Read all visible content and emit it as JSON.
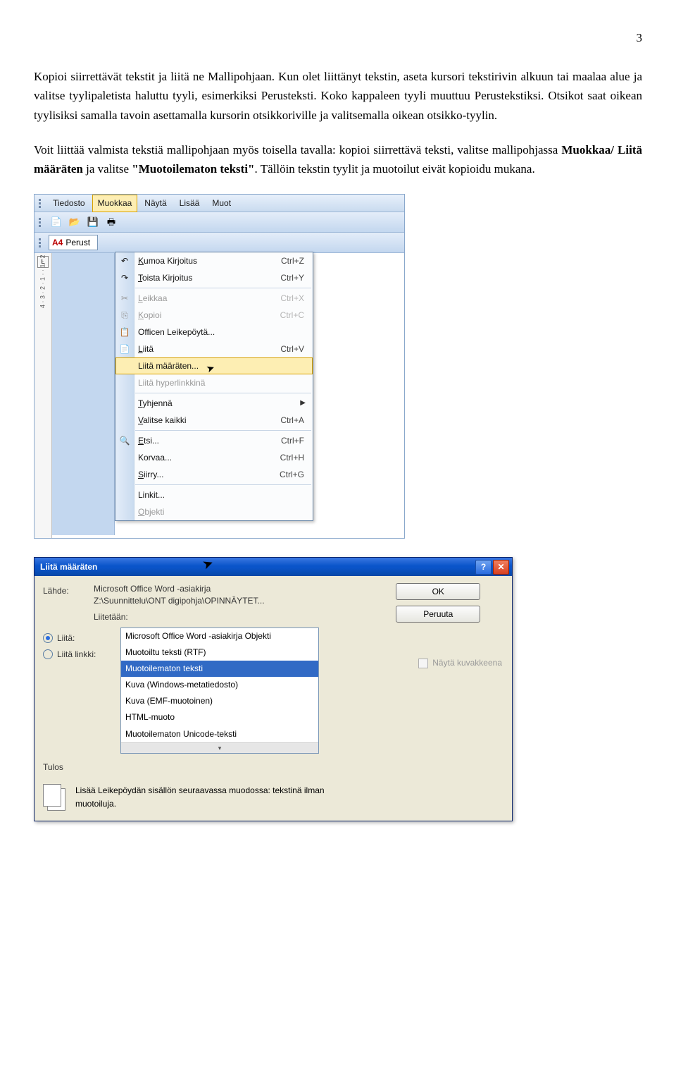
{
  "page_number": "3",
  "paragraphs": {
    "p1": "Kopioi siirrettävät tekstit ja liitä ne Mallipohjaan. Kun olet liittänyt tekstin, aseta kursori tekstirivin alkuun tai maalaa alue ja valitse tyylipaletista haluttu tyyli, esimerkiksi Perusteksti. Koko kappaleen tyyli muuttuu Perustekstiksi. Otsikot saat oikean tyylisiksi samalla tavoin asettamalla kursorin otsikkoriville ja valitsemalla oikean otsikko-tyylin.",
    "p2_a": "Voit liittää valmista tekstiä mallipohjaan myös toisella tavalla: kopioi siirrettävä teksti, valitse mallipohjassa ",
    "p2_b": "Muokkaa/ Liitä määräten",
    "p2_c": " ja valitse ",
    "p2_d": "\"Muotoilematon teksti\"",
    "p2_e": ". Tällöin tekstin tyylit ja muotoilut eivät kopioidu mukana."
  },
  "word_ui": {
    "menubar": [
      "Tiedosto",
      "Muokkaa",
      "Näytä",
      "Lisää",
      "Muot"
    ],
    "style_prefix": "A4",
    "style_name": "Perust",
    "ruler_L": "L",
    "ruler_ticks": [
      "·",
      "1",
      "·",
      "2",
      "·",
      "1",
      "·",
      "1",
      "·",
      "·",
      "2",
      "·",
      "3",
      "·",
      "4"
    ],
    "menu_items": [
      {
        "label_pre": "K",
        "label_rest": "umoa Kirjoitus",
        "shortcut": "Ctrl+Z",
        "disabled": false,
        "glyph": "↶"
      },
      {
        "label_pre": "T",
        "label_rest": "oista Kirjoitus",
        "shortcut": "Ctrl+Y",
        "disabled": false,
        "glyph": "↷"
      },
      {
        "sep": true
      },
      {
        "label_pre": "L",
        "label_rest": "eikkaa",
        "shortcut": "Ctrl+X",
        "disabled": true,
        "glyph": "✂"
      },
      {
        "label_pre": "K",
        "label_rest": "opioi",
        "shortcut": "Ctrl+C",
        "disabled": true,
        "glyph": "⎘"
      },
      {
        "label_pre": "",
        "label_rest": "Officen Leikepöytä...",
        "shortcut": "",
        "disabled": false,
        "glyph": "📋"
      },
      {
        "label_pre": "L",
        "label_rest": "iitä",
        "shortcut": "Ctrl+V",
        "disabled": false,
        "glyph": "📄"
      },
      {
        "label_pre": "",
        "label_rest": "Liitä määräten...",
        "shortcut": "",
        "disabled": false,
        "hover": true
      },
      {
        "label_pre": "",
        "label_rest": "Liitä hyperlinkkinä",
        "shortcut": "",
        "disabled": true
      },
      {
        "sep": true
      },
      {
        "label_pre": "T",
        "label_rest": "yhjennä",
        "submenu": true,
        "disabled": false
      },
      {
        "label_pre": "V",
        "label_rest": "alitse kaikki",
        "shortcut": "Ctrl+A",
        "disabled": false
      },
      {
        "sep": true
      },
      {
        "label_pre": "E",
        "label_rest": "tsi...",
        "shortcut": "Ctrl+F",
        "disabled": false,
        "glyph": "🔍"
      },
      {
        "label_pre": "",
        "label_rest": "Korvaa...",
        "shortcut": "Ctrl+H",
        "disabled": false
      },
      {
        "label_pre": "S",
        "label_rest": "iirry...",
        "shortcut": "Ctrl+G",
        "disabled": false
      },
      {
        "sep": true
      },
      {
        "label_pre": "",
        "label_rest": "Linkit...",
        "shortcut": "",
        "disabled": false
      },
      {
        "label_pre": "O",
        "label_rest": "bjekti",
        "shortcut": "",
        "disabled": true
      }
    ]
  },
  "dialog": {
    "title": "Liitä määräten",
    "source_label": "Lähde:",
    "source_line1": "Microsoft Office Word -asiakirja",
    "source_path": "Z:\\Suunnittelu\\ONT digipohja\\OPINNÄYTET...",
    "liitetaan_label": "Liitetään:",
    "radio1": "Liitä:",
    "radio2": "Liitä linkki:",
    "options": [
      "Microsoft Office Word -asiakirja Objekti",
      "Muotoiltu teksti (RTF)",
      "Muotoilematon teksti",
      "Kuva (Windows-metatiedosto)",
      "Kuva (EMF-muotoinen)",
      "HTML-muoto",
      "Muotoilematon Unicode-teksti"
    ],
    "selected_option_index": 2,
    "ok": "OK",
    "cancel": "Peruuta",
    "show_as_icon": "Näytä kuvakkeena",
    "result_label": "Tulos",
    "result_text": "Lisää Leikepöydän sisällön seuraavassa muodossa: tekstinä ilman muotoiluja."
  }
}
